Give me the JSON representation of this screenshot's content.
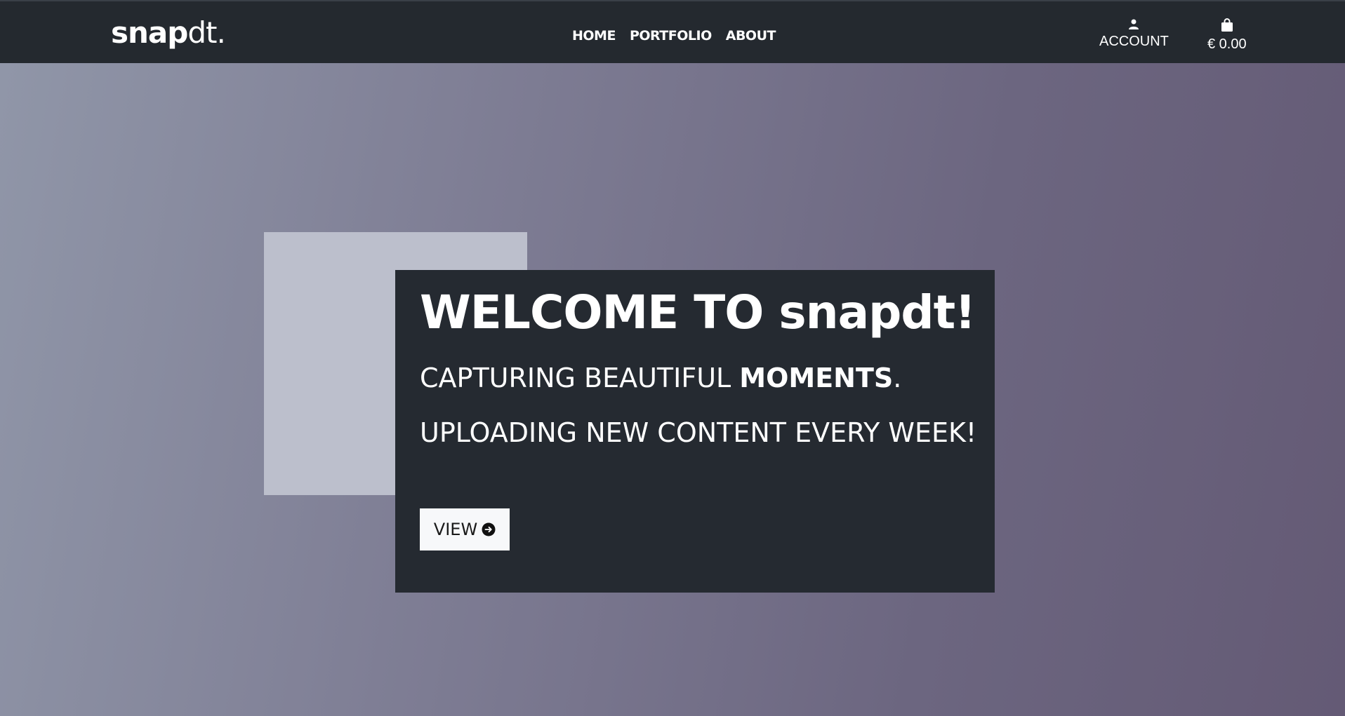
{
  "header": {
    "logo_bold": "snap",
    "logo_regular": "dt.",
    "nav": [
      "HOME",
      "PORTFOLIO",
      "ABOUT"
    ],
    "account_label": "ACCOUNT",
    "cart_total": "€ 0.00"
  },
  "hero": {
    "title": "WELCOME TO snapdt!",
    "line1_regular": "CAPTURING BEAUTIFUL ",
    "line1_bold": "MOMENTS",
    "line1_end": ".",
    "line2": "UPLOADING NEW CONTENT EVERY WEEK!",
    "button_label": "VIEW"
  },
  "colors": {
    "navbar_bg": "#24292f",
    "card_bg": "#252a31",
    "accent_square": "#bcbfcc",
    "gradient_start": "#9096a8",
    "gradient_end": "#645a75",
    "button_bg": "#f7f8fa"
  },
  "icons": {
    "account": "user-icon",
    "cart": "shopping-bag-icon",
    "button": "arrow-right-circle-icon"
  }
}
